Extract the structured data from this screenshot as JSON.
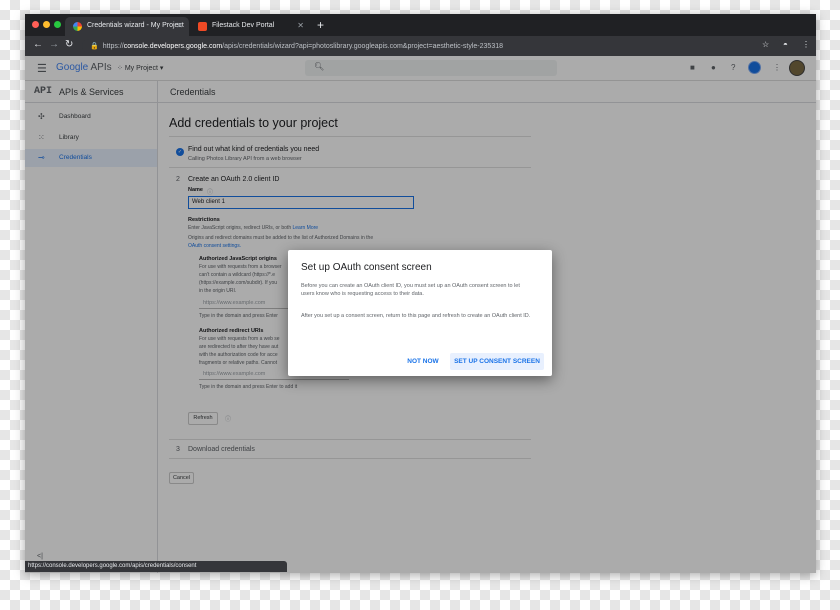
{
  "browser": {
    "tabs": [
      {
        "title": "Credentials wizard - My Project",
        "active": true
      },
      {
        "title": "Filestack Dev Portal",
        "active": false
      }
    ],
    "new_tab_label": "+",
    "url_prefix": "https://",
    "url_host": "console.developers.google.com",
    "url_path": "/apis/credentials/wizard?api=photoslibrary.googleapis.com&project=aesthetic-style-235318",
    "status_url": "https://console.developers.google.com/apis/credentials/consent"
  },
  "header": {
    "logo_google": "Google",
    "logo_apis": "APIs",
    "project_name": "My Project"
  },
  "subheader": {
    "api_icon": "API",
    "section_title": "APIs & Services",
    "page_title": "Credentials"
  },
  "sidebar": {
    "items": [
      {
        "label": "Dashboard",
        "icon": "dashboard-icon"
      },
      {
        "label": "Library",
        "icon": "library-icon"
      },
      {
        "label": "Credentials",
        "icon": "key-icon",
        "active": true
      }
    ],
    "collapse_label": "<|"
  },
  "main": {
    "title": "Add credentials to your project",
    "step1": {
      "title": "Find out what kind of credentials you need",
      "subtitle": "Calling Photos Library API from a web browser"
    },
    "step2": {
      "number": "2",
      "title": "Create an OAuth 2.0 client ID",
      "name_label": "Name",
      "name_value": "Web client 1",
      "restrictions_label": "Restrictions",
      "restrictions_text": "Enter JavaScript origins, redirect URIs, or both",
      "learn_more": "Learn More",
      "origins_note": "Origins and redirect domains must be added to the list of Authorized Domains in the",
      "consent_settings_link": "OAuth consent settings.",
      "js_origins_label": "Authorized JavaScript origins",
      "js_origins_lines": [
        "For use with requests from a browser",
        "can't contain a wildcard (https://*.e",
        "(https://example.com/subdir). If you",
        "in the origin URI."
      ],
      "js_origins_placeholder": "https://www.example.com",
      "js_origins_hint": "Type in the domain and press Enter",
      "redirect_label": "Authorized redirect URIs",
      "redirect_lines": [
        "For use with requests from a web se",
        "are redirected to after they have aut",
        "with the authorization code for acce",
        "fragments or relative paths. Cannot"
      ],
      "redirect_placeholder": "https://www.example.com",
      "redirect_hint": "Type in the domain and press Enter to add it",
      "refresh_label": "Refresh"
    },
    "step3": {
      "number": "3",
      "title": "Download credentials"
    },
    "cancel_label": "Cancel"
  },
  "dialog": {
    "title": "Set up OAuth consent screen",
    "para1": "Before you can create an OAuth client ID, you must set up an OAuth consent screen to let users know who is requesting access to their data.",
    "para2": "After you set up a consent screen, return to this page and refresh to create an OAuth client ID.",
    "not_now": "NOT NOW",
    "setup": "SET UP CONSENT SCREEN"
  }
}
